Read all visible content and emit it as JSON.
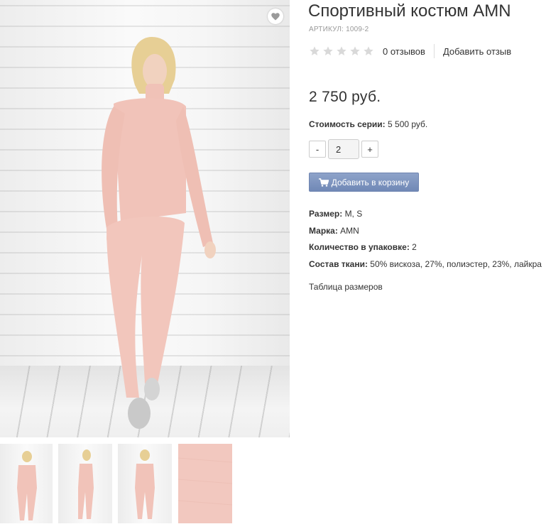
{
  "product": {
    "title": "Спортивный костюм AMN",
    "sku": "АРТИКУЛ: 1009-2",
    "rating_stars": 0,
    "reviews_link": "0 отзывов",
    "add_review_link": "Добавить отзыв",
    "price": "2 750 руб.",
    "series_label": "Стоимость серии:",
    "series_value": "5 500 руб.",
    "quantity": "2",
    "qty_minus": "-",
    "qty_plus": "+",
    "add_to_cart": "Добавить в корзину",
    "size_table_link": "Таблица размеров"
  },
  "specs": [
    {
      "label": "Размер:",
      "value": "M, S"
    },
    {
      "label": "Марка:",
      "value": "AMN"
    },
    {
      "label": "Количество в упаковке:",
      "value": "2"
    },
    {
      "label": "Состав ткани:",
      "value": "50% вискоза, 27%, полиэстер, 23%, лайкра"
    }
  ],
  "icons": {
    "favorite": "heart-icon",
    "star": "star-icon",
    "cart": "shopping-cart-icon"
  },
  "colors": {
    "button_bg": "#7a90bd",
    "star_empty": "#d9d9d9",
    "garment_pink": "#f1c3b9"
  }
}
